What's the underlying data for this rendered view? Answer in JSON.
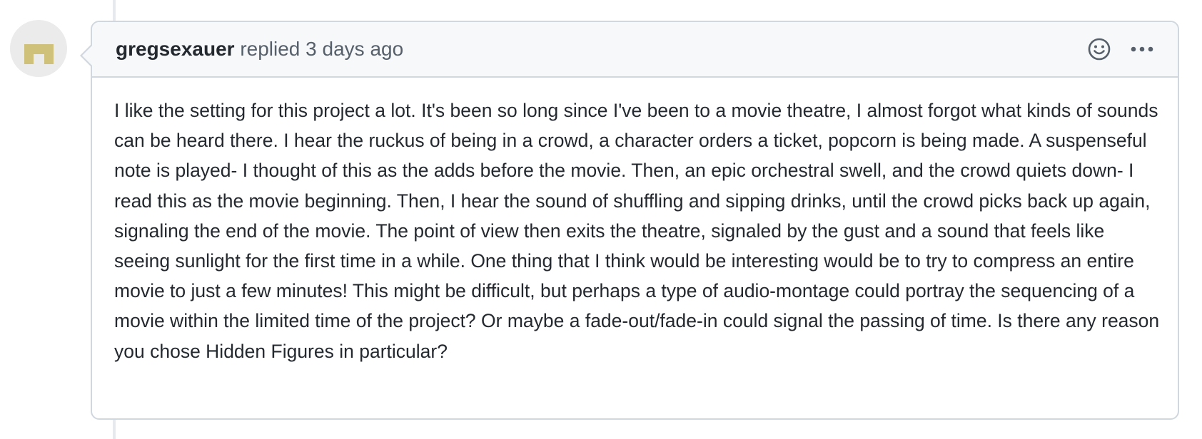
{
  "comment": {
    "author": "gregsexauer",
    "action_text": "replied",
    "timestamp": "3 days ago",
    "body": "I like the setting for this project a lot. It's been so long since I've been to a movie theatre, I almost forgot what kinds of sounds can be heard there. I hear the ruckus of being in a crowd, a character orders a ticket, popcorn is being made. A suspenseful note is played- I thought of this as the adds before the movie. Then, an epic orchestral swell, and the crowd quiets down- I read this as the movie beginning. Then, I hear the sound of shuffling and sipping drinks, until the crowd picks back up again, signaling the end of the movie. The point of view then exits the theatre, signaled by the gust and a sound that feels like seeing sunlight for the first time in a while. One thing that I think would be interesting would be to try to compress an entire movie to just a few minutes! This might be difficult, but perhaps a type of audio-montage could portray the sequencing of a movie within the limited time of the project? Or maybe a fade-out/fade-in could signal the passing of time. Is there any reason you chose Hidden Figures in particular?"
  },
  "icons": {
    "avatar": "identicon-avatar",
    "reaction": "smiley-icon",
    "more": "kebab-horizontal-icon"
  },
  "colors": {
    "header_bg": "#f6f8fa",
    "border": "#d0d7de",
    "text": "#24292f",
    "muted": "#57606a",
    "avatar_fill": "#cfc07a"
  }
}
